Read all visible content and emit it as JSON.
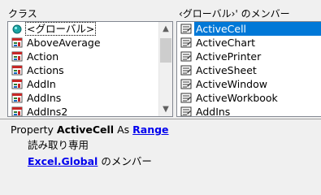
{
  "classes_pane": {
    "label": "クラス",
    "items": [
      {
        "label": "<グローバル>",
        "icon": "globe-icon",
        "selected": true
      },
      {
        "label": "AboveAverage",
        "icon": "class-icon"
      },
      {
        "label": "Action",
        "icon": "class-icon"
      },
      {
        "label": "Actions",
        "icon": "class-icon"
      },
      {
        "label": "AddIn",
        "icon": "class-icon"
      },
      {
        "label": "AddIns",
        "icon": "class-icon"
      },
      {
        "label": "AddIns2",
        "icon": "class-icon"
      }
    ]
  },
  "members_pane": {
    "label": "‹グローバル›' のメンバー",
    "items": [
      {
        "label": "ActiveCell",
        "icon": "property-icon",
        "selected": true
      },
      {
        "label": "ActiveChart",
        "icon": "property-icon"
      },
      {
        "label": "ActivePrinter",
        "icon": "property-icon"
      },
      {
        "label": "ActiveSheet",
        "icon": "property-icon"
      },
      {
        "label": "ActiveWindow",
        "icon": "property-icon"
      },
      {
        "label": "ActiveWorkbook",
        "icon": "property-icon"
      },
      {
        "label": "AddIns",
        "icon": "property-icon"
      }
    ]
  },
  "details": {
    "keyword": "Property",
    "member": "ActiveCell",
    "as_keyword": "As",
    "type_link": "Range",
    "access": "読み取り専用",
    "library": "Excel",
    "dot": ".",
    "scope": "Global",
    "member_of_suffix": "のメンバー"
  },
  "colors": {
    "selection": "#0078d7",
    "link": "#0000ee"
  }
}
